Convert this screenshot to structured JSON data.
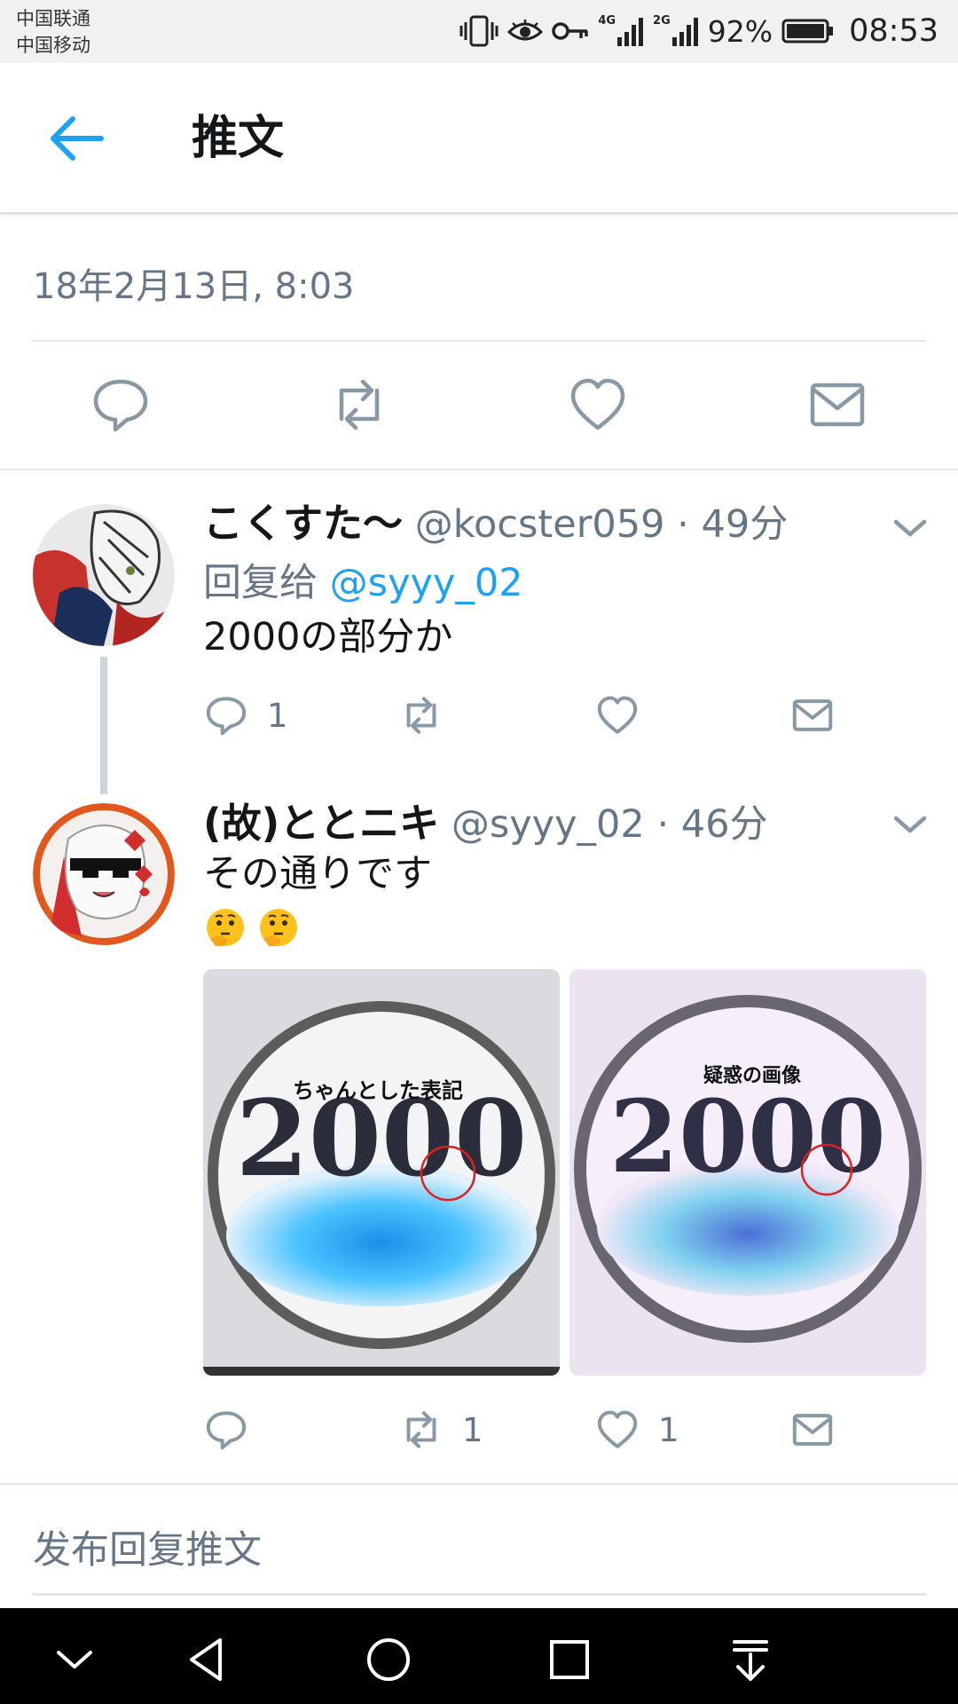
{
  "status_bar": {
    "carrier_1": "中国联通",
    "carrier_2": "中国移动",
    "network_1": "4G",
    "network_2": "2G",
    "battery": "92%",
    "time": "08:53",
    "icons": [
      "vibrate-icon",
      "eye-icon",
      "key-icon",
      "signal-icon",
      "signal-icon",
      "battery-icon"
    ]
  },
  "header": {
    "back_icon": "arrow-left-icon",
    "title": "推文"
  },
  "main_tweet": {
    "timestamp": "18年2月13日, 8:03",
    "actions": [
      "reply-icon",
      "retweet-icon",
      "like-icon",
      "message-icon"
    ]
  },
  "replies": [
    {
      "name": "こくすた～",
      "handle": "@kocster059",
      "time": "· 49分",
      "reply_to_label": "回复给",
      "reply_to_mention": "@syyy_02",
      "text": "2000の部分か",
      "reply_count": "1",
      "retweet_count": "",
      "like_count": ""
    },
    {
      "name": "(故)ととニキ",
      "handle": "@syyy_02",
      "time": "· 46分",
      "text": "その通りです",
      "emoji": "🤔🤔",
      "reply_count": "",
      "retweet_count": "1",
      "like_count": "1",
      "media": [
        {
          "caption": "ちゃんとした表記",
          "number": "2000"
        },
        {
          "caption": "疑惑の画像",
          "number": "2000"
        }
      ]
    }
  ],
  "compose": {
    "placeholder": "发布回复推文"
  },
  "nav_bar": {
    "icons": [
      "chevron-down-icon",
      "back-triangle-icon",
      "home-circle-icon",
      "recents-square-icon",
      "notification-pull-icon"
    ]
  },
  "colors": {
    "accent": "#1da1f2",
    "secondary_text": "#657786",
    "icon_gray": "#8899a6"
  }
}
